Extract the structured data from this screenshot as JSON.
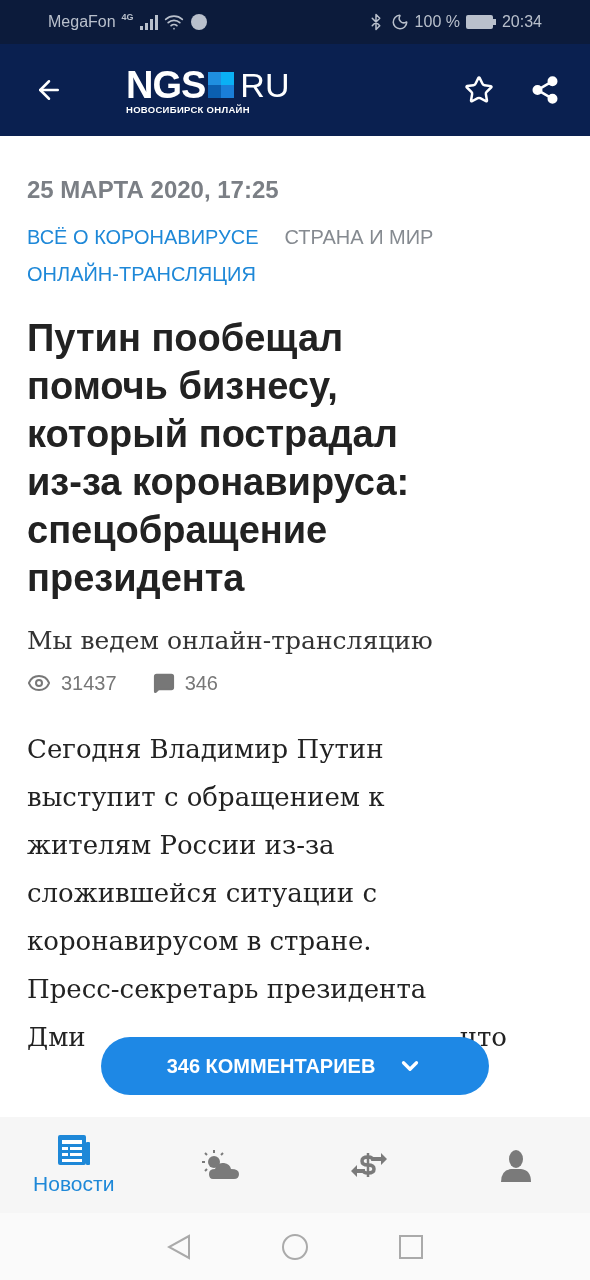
{
  "status_bar": {
    "carrier": "MegaFon",
    "network": "4G",
    "battery": "100 %",
    "time": "20:34"
  },
  "header": {
    "logo": {
      "main": "NGS",
      "domain": "RU",
      "subtitle": "НОВОСИБИРСК ОНЛАЙН"
    },
    "bookmarked": false
  },
  "article": {
    "date": "25 МАРТА 2020, 17:25",
    "tags": [
      {
        "label": "ВСЁ О КОРОНАВИРУСЕ",
        "highlighted": true
      },
      {
        "label": "СТРАНА И МИР",
        "highlighted": false
      },
      {
        "label": "ОНЛАЙН-ТРАНСЛЯЦИЯ",
        "highlighted": true
      }
    ],
    "title": "Путин пообещал помочь бизнесу, который пострадал из-за коронавируса: спецобращение президента",
    "lead": "Мы ведем онлайн-трансляцию",
    "views": "31437",
    "comments": "346",
    "body": "Сегодня Владимир Путин\nвыступит с обращением к\nжителям России из-за\nсложившейся ситуации с\nкоронавирусом в стране.\nПресс-секретарь президента",
    "body_fragments": [
      "Дми",
      "что"
    ]
  },
  "comments_button": {
    "label": "346 КОММЕНТАРИЕВ"
  },
  "bottom_nav": [
    {
      "kind": "news",
      "label": "Новости",
      "selected": true
    },
    {
      "kind": "weather",
      "selected": false
    },
    {
      "kind": "currency",
      "selected": false
    },
    {
      "kind": "profile",
      "selected": false
    }
  ]
}
